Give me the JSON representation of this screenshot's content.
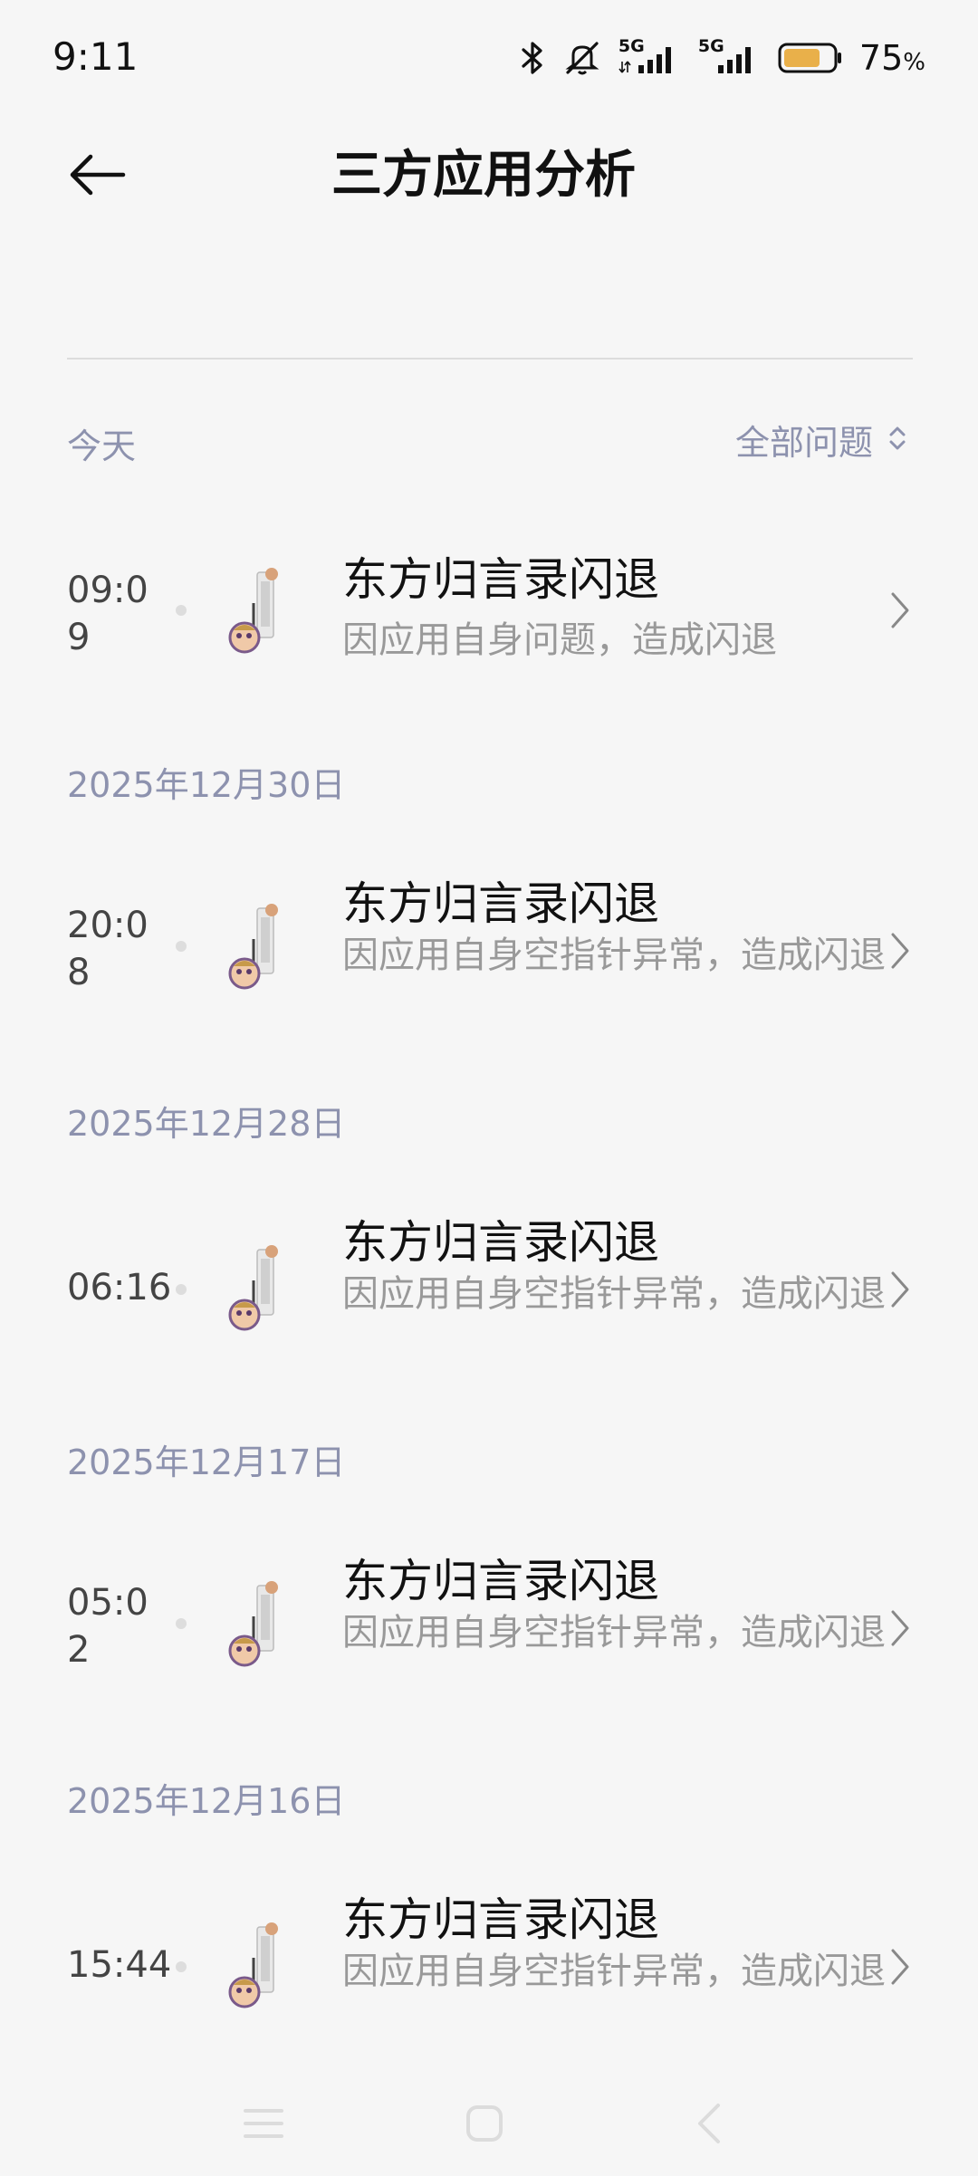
{
  "status_bar": {
    "time": "9:11",
    "network_1": "5G",
    "network_2": "5G",
    "battery_level": 0.75,
    "battery_percent": "75",
    "battery_unit": "%"
  },
  "header": {
    "title": "三方应用分析"
  },
  "filter": {
    "today_label": "今天",
    "label": "全部问题"
  },
  "groups": [
    {
      "date": "今天",
      "entries": [
        {
          "time": "09:09",
          "title": "东方归言录闪退",
          "desc": "因应用自身问题，造成闪退"
        }
      ]
    },
    {
      "date": "2025年12月30日",
      "entries": [
        {
          "time": "20:08",
          "title": "东方归言录闪退",
          "desc": "因应用自身空指针异常，造成闪退"
        }
      ]
    },
    {
      "date": "2025年12月28日",
      "entries": [
        {
          "time": "06:16",
          "title": "东方归言录闪退",
          "desc": "因应用自身空指针异常，造成闪退"
        }
      ]
    },
    {
      "date": "2025年12月17日",
      "entries": [
        {
          "time": "05:02",
          "title": "东方归言录闪退",
          "desc": "因应用自身空指针异常，造成闪退"
        }
      ]
    },
    {
      "date": "2025年12月16日",
      "entries": [
        {
          "time": "15:44",
          "title": "东方归言录闪退",
          "desc": "因应用自身空指针异常，造成闪退"
        }
      ]
    }
  ],
  "colors": {
    "background": "#f6f6f6",
    "accent_text": "#8d92ae",
    "secondary_text": "#999999",
    "battery_fill": "#e9b04a"
  }
}
